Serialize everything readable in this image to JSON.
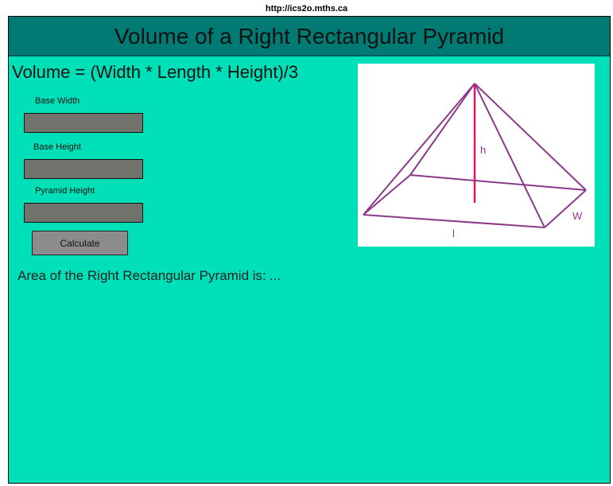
{
  "browser": {
    "url": "http://ics2o.mths.ca"
  },
  "header": {
    "title": "Volume of a Right Rectangular Pyramid"
  },
  "formula": "Volume = (Width * Length * Height)/3",
  "form": {
    "base_width_label": "Base Width",
    "base_width_value": "",
    "base_height_label": "Base Height",
    "base_height_value": "",
    "pyramid_height_label": "Pyramid Height",
    "pyramid_height_value": "",
    "calculate_label": "Calculate"
  },
  "result": {
    "label": "Area of the Right Rectangular Pyramid is:",
    "value": "..."
  },
  "diagram": {
    "height_label": "h",
    "width_label": "W",
    "length_label": "l",
    "edge_color": "#8b3a8b",
    "height_color": "#d11a6a"
  },
  "colors": {
    "page_background": "#00e0b8",
    "header_background": "#007a73",
    "input_background": "#6f736c",
    "button_background": "#8c8c8c"
  }
}
